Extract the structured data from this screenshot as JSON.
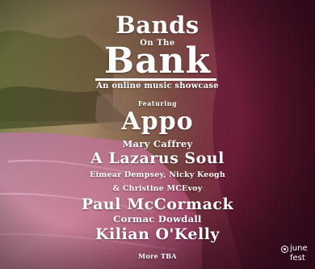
{
  "poster": {
    "title_line1": "Bands",
    "title_line2": "On The",
    "title_line3": "Bank",
    "subtitle": "An online music showcase",
    "featuring": "Featuring",
    "artists": [
      "Appo",
      "Mary Caffrey",
      "A Lazarus Soul",
      "Eimear Dempsey, Nicky Keogh",
      "& Christine MCEvoy",
      "Paul McCormack",
      "Cormac Dowdall",
      "Kilian O'Kelly"
    ],
    "footer": "More TBA"
  },
  "logo": {
    "word1": "june",
    "word2": "fest"
  },
  "colors": {
    "magenta": "#8a1c48",
    "dark_crimson": "#3a0f1e",
    "water_pink": "#e69ab2",
    "olive_green": "#6f7a3e",
    "text": "#ffffff"
  }
}
